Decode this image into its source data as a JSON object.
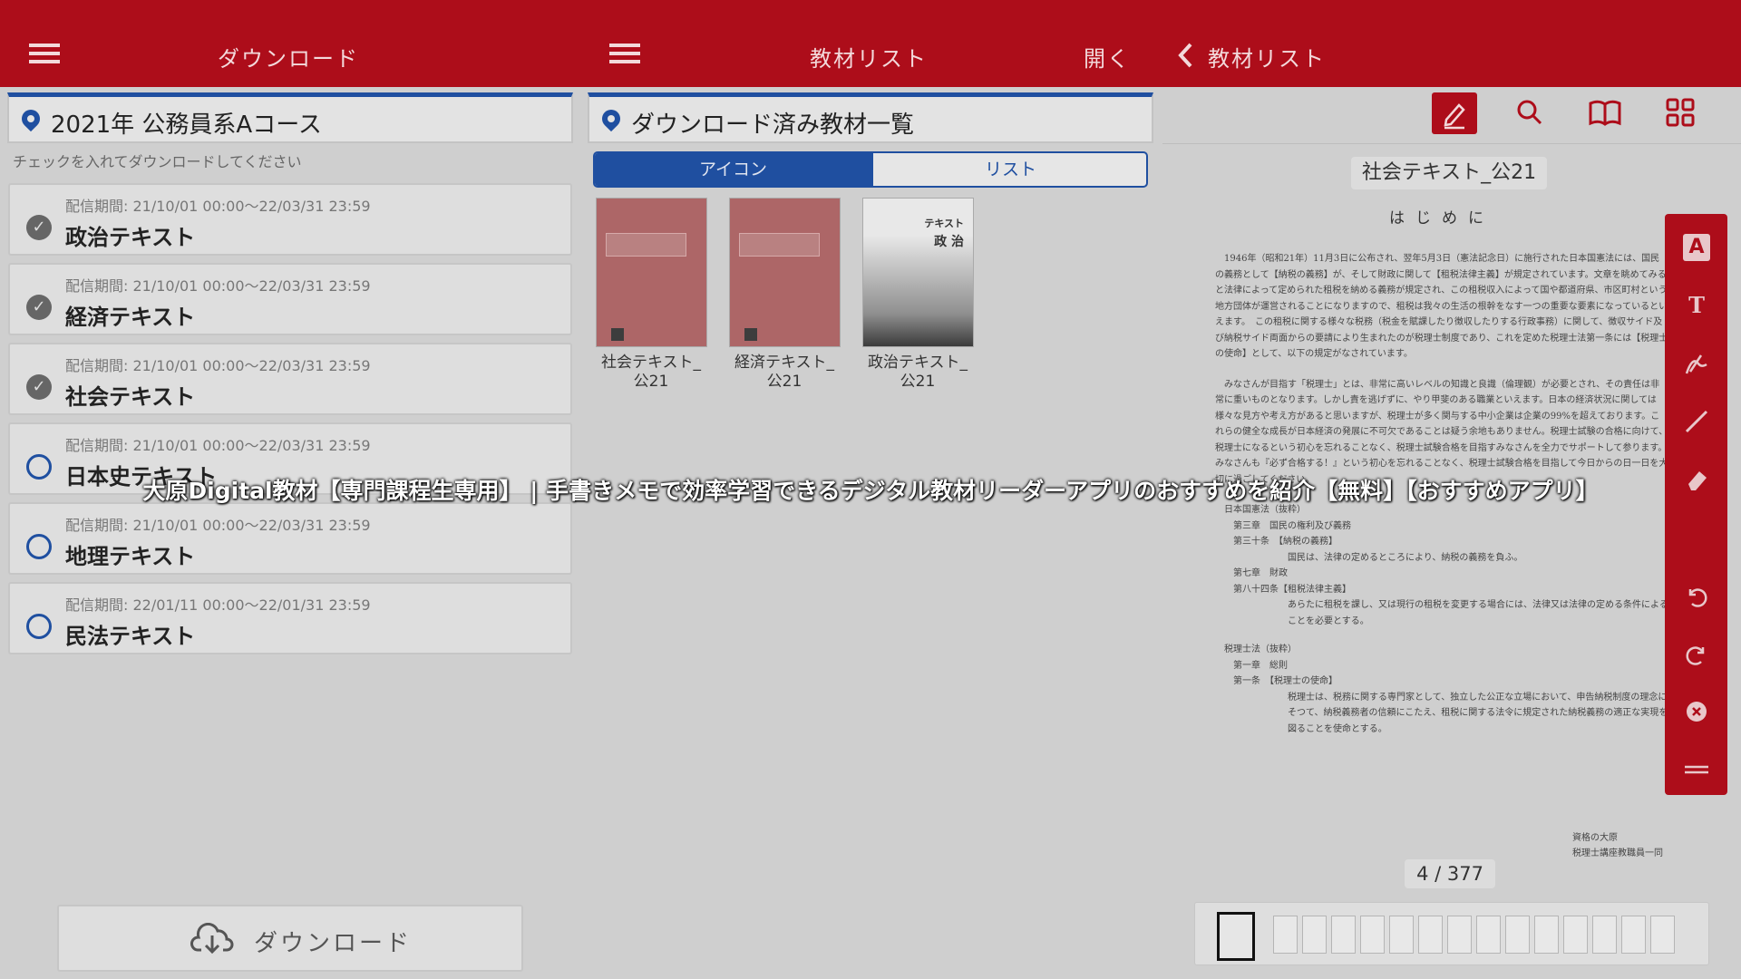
{
  "header": {
    "left_title": "ダウンロード",
    "center_title": "教材リスト",
    "open_label": "開く",
    "back_label": "教材リスト"
  },
  "download_panel": {
    "heading": "2021年 公務員系Aコース",
    "hint": "チェックを入れてダウンロードしてください",
    "items": [
      {
        "period": "配信期間:  21/10/01 00:00～22/03/31 23:59",
        "title": "政治テキスト",
        "checked": true
      },
      {
        "period": "配信期間:  21/10/01 00:00～22/03/31 23:59",
        "title": "経済テキスト",
        "checked": true
      },
      {
        "period": "配信期間:  21/10/01 00:00～22/03/31 23:59",
        "title": "社会テキスト",
        "checked": true
      },
      {
        "period": "配信期間:  21/10/01 00:00～22/03/31 23:59",
        "title": "日本史テキスト",
        "checked": false
      },
      {
        "period": "配信期間:  21/10/01 00:00～22/03/31 23:59",
        "title": "地理テキスト",
        "checked": false
      },
      {
        "period": "配信期間:  22/01/11 00:00～22/01/31 23:59",
        "title": "民法テキスト",
        "checked": false
      }
    ],
    "download_button": "ダウンロード"
  },
  "material_panel": {
    "heading": "ダウンロード済み教材一覧",
    "tab_icon": "アイコン",
    "tab_list": "リスト",
    "books": [
      {
        "line1": "社会テキスト_",
        "line2": "公21"
      },
      {
        "line1": "経済テキスト_",
        "line2": "公21"
      },
      {
        "line1": "政治テキスト_",
        "line2": "公21",
        "cover_label": "テキスト",
        "cover_subject": "政 治"
      }
    ]
  },
  "viewer": {
    "doc_title": "社会テキスト_公21",
    "page_heading": "はじめに",
    "para1": "1946年（昭和21年）11月3日に公布され、翌年5月3日（憲法記念日）に施行された日本国憲法には、国民の義務として【納税の義務】が、そして財政に関して【租税法律主義】が規定されています。文章を眺めてみると法律によって定められた租税を納める義務が規定され、この租税収入によって国や都道府県、市区町村という地方団体が運営されることになりますので、租税は我々の生活の根幹をなす一つの重要な要素になっているといえます。　この租税に関する様々な税務（税金を賦課したり徴収したりする行政事務）に関して、徴収サイド及び納税サイド両面からの要請により生まれたのが税理士制度であり、これを定めた税理士法第一条には【税理士の使命】として、以下の規定がなされています。",
    "para2": "みなさんが目指す「税理士」とは、非常に高いレベルの知識と良識（倫理観）が必要とされ、その責任は非常に重いものとなります。しかし責を逃げずに、やり甲斐のある職業といえます。日本の経済状況に関しては様々な見方や考え方があると思いますが、税理士が多く関与する中小企業は企業の99%を超えております。これらの健全な成長が日本経済の発展に不可欠であることは疑う余地もありません。税理士試験の合格に向けて、税理士になるという初心を忘れることなく、税理士試験合格を目指すみなさんを全力でサポートして参ります。みなさんも『必ず合格する！』という初心を忘れることなく、税理士試験合格を目指して今日からの日一日を大切に過ごしてください。",
    "law_lines": [
      "日本国憲法（抜粋）",
      "第三章　国民の権利及び義務",
      "第三十条　【納税の義務】",
      "国民は、法律の定めるところにより、納税の義務を負ふ。",
      "第七章　財政",
      "第八十四条【租税法律主義】",
      "あらたに租税を課し、又は現行の租税を変更する場合には、法律又は法律の定める条件によることを必要とする。",
      "税理士法（抜粋）",
      "第一章　総則",
      "第一条　【税理士の使命】",
      "税理士は、税務に関する専門家として、独立した公正な立場において、申告納税制度の理念にそつて、納税義務者の信頼にこたえ、租税に関する法令に規定された納税義務の適正な実現を図ることを使命とする。"
    ],
    "signature1": "資格の大原",
    "signature2": "税理士講座教職員一同",
    "page_indicator": "4 / 377"
  },
  "caption": "大原Digital教材【専門課程生専用】 | 手書きメモで効率学習できるデジタル教材リーダーアプリのおすすめを紹介【無料】【おすすめアプリ】",
  "icons": [
    "menu-icon",
    "pin-icon",
    "check-icon",
    "cloud-download-icon",
    "chevron-left-icon",
    "pen-icon",
    "search-icon",
    "book-icon",
    "grid-icon",
    "text-box-icon",
    "text-icon",
    "handwriting-icon",
    "line-icon",
    "eraser-icon",
    "undo-icon",
    "redo-icon",
    "close-icon",
    "drag-handle-icon"
  ],
  "colors": {
    "brand_red": "#ad0d1a",
    "accent_blue": "#1f4fa0"
  }
}
